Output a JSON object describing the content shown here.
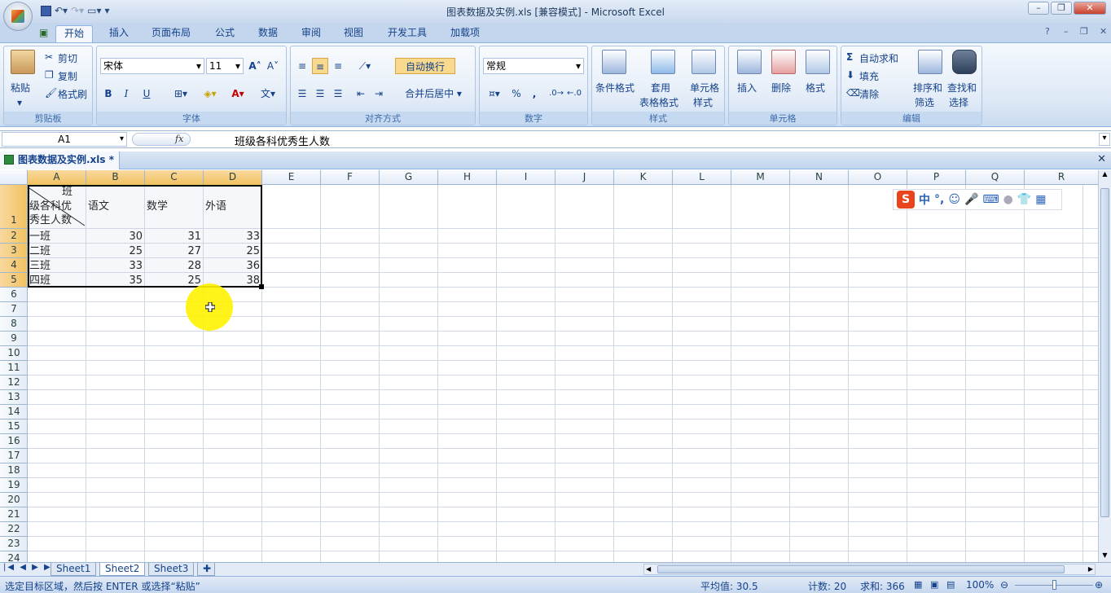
{
  "window": {
    "title": "图表数据及实例.xls  [兼容模式] - Microsoft Excel"
  },
  "tabs": [
    "开始",
    "插入",
    "页面布局",
    "公式",
    "数据",
    "审阅",
    "视图",
    "开发工具",
    "加载项"
  ],
  "ribbon": {
    "clipboard": {
      "paste": "粘贴",
      "cut": "剪切",
      "copy": "复制",
      "format_painter": "格式刷",
      "label": "剪贴板"
    },
    "font": {
      "name": "宋体",
      "size": "11",
      "bold": "B",
      "italic": "I",
      "underline": "U",
      "label": "字体"
    },
    "alignment": {
      "wrap": "自动换行",
      "merge": "合并后居中",
      "label": "对齐方式"
    },
    "number": {
      "format": "常规",
      "percent": "%",
      "comma": ",",
      "label": "数字"
    },
    "styles": {
      "cond": "条件格式",
      "table": "套用",
      "table2": "表格格式",
      "cell": "单元格",
      "cell2": "样式",
      "label": "样式"
    },
    "cells": {
      "insert": "插入",
      "delete": "删除",
      "format": "格式",
      "label": "单元格"
    },
    "editing": {
      "autosum": "自动求和",
      "fill": "填充",
      "clear": "清除",
      "sort": "排序和",
      "sort2": "筛选",
      "find": "查找和",
      "find2": "选择",
      "label": "编辑"
    }
  },
  "formula": {
    "namebox": "A1",
    "fx": "fx",
    "content": "班级各科优秀生人数"
  },
  "doc_tab": "图表数据及实例.xls *",
  "columns": [
    "A",
    "B",
    "C",
    "D",
    "E",
    "F",
    "G",
    "H",
    "I",
    "J",
    "K",
    "L",
    "M",
    "N",
    "O",
    "P",
    "Q",
    "R"
  ],
  "rows": [
    "1",
    "2",
    "3",
    "4",
    "5",
    "6",
    "7",
    "8",
    "9",
    "10",
    "11",
    "12",
    "13",
    "14",
    "15",
    "16",
    "17",
    "18",
    "19",
    "20",
    "21",
    "22",
    "23",
    "24"
  ],
  "header_cell": {
    "top": "班",
    "mid": "级各科优",
    "bottom": "秀生人数"
  },
  "headers": [
    "语文",
    "数学",
    "外语"
  ],
  "data": [
    {
      "name": "一班",
      "v": [
        "30",
        "31",
        "33"
      ]
    },
    {
      "name": "二班",
      "v": [
        "25",
        "27",
        "25"
      ]
    },
    {
      "name": "三班",
      "v": [
        "33",
        "28",
        "36"
      ]
    },
    {
      "name": "四班",
      "v": [
        "35",
        "25",
        "38"
      ]
    }
  ],
  "sheets": [
    "Sheet1",
    "Sheet2",
    "Sheet3"
  ],
  "status": {
    "msg": "选定目标区域，然后按 ENTER 或选择“粘贴”",
    "avg": "平均值: 30.5",
    "count": "计数: 20",
    "sum": "求和: 366",
    "zoom": "100%"
  },
  "ime": {
    "label": "中"
  }
}
